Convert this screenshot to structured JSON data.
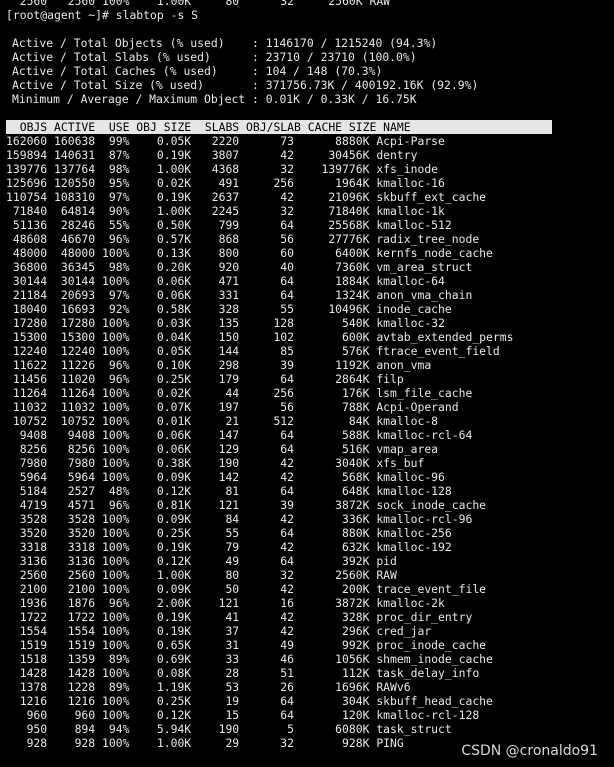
{
  "terminal": {
    "partial_top_line": "  2560   2560 100%    1.00K     80      32     2560K RAW",
    "prompt": "[root@agent ~]# slabtop -s S",
    "summary": [
      "Active / Total Objects (% used)    : 1146170 / 1215240 (94.3%)",
      "Active / Total Slabs (% used)      : 23710 / 23710 (100.0%)",
      "Active / Total Caches (% used)     : 104 / 148 (70.3%)",
      "Active / Total Size (% used)       : 371756.73K / 400192.16K (92.9%)",
      "Minimum / Average / Maximum Object : 0.01K / 0.33K / 16.75K"
    ],
    "header": "  OBJS ACTIVE  USE OBJ SIZE  SLABS OBJ/SLAB CACHE SIZE NAME",
    "rows": [
      "162060 160638  99%    0.05K   2220      73      8880K Acpi-Parse",
      "159894 140631  87%    0.19K   3807      42     30456K dentry",
      "139776 137764  98%    1.00K   4368      32    139776K xfs_inode",
      "125696 120550  95%    0.02K    491     256      1964K kmalloc-16",
      "110754 108310  97%    0.19K   2637      42     21096K skbuff_ext_cache",
      " 71840  64814  90%    1.00K   2245      32     71840K kmalloc-1k",
      " 51136  28246  55%    0.50K    799      64     25568K kmalloc-512",
      " 48608  46670  96%    0.57K    868      56     27776K radix_tree_node",
      " 48000  48000 100%    0.13K    800      60      6400K kernfs_node_cache",
      " 36800  36345  98%    0.20K    920      40      7360K vm_area_struct",
      " 30144  30144 100%    0.06K    471      64      1884K kmalloc-64",
      " 21184  20693  97%    0.06K    331      64      1324K anon_vma_chain",
      " 18040  16693  92%    0.58K    328      55     10496K inode_cache",
      " 17280  17280 100%    0.03K    135     128       540K kmalloc-32",
      " 15300  15300 100%    0.04K    150     102       600K avtab_extended_perms",
      " 12240  12240 100%    0.05K    144      85       576K ftrace_event_field",
      " 11622  11226  96%    0.10K    298      39      1192K anon_vma",
      " 11456  11020  96%    0.25K    179      64      2864K filp",
      " 11264  11264 100%    0.02K     44     256       176K lsm_file_cache",
      " 11032  11032 100%    0.07K    197      56       788K Acpi-Operand",
      " 10752  10752 100%    0.01K     21     512        84K kmalloc-8",
      "  9408   9408 100%    0.06K    147      64       588K kmalloc-rcl-64",
      "  8256   8256 100%    0.06K    129      64       516K vmap_area",
      "  7980   7980 100%    0.38K    190      42      3040K xfs_buf",
      "  5964   5964 100%    0.09K    142      42       568K kmalloc-96",
      "  5184   2527  48%    0.12K     81      64       648K kmalloc-128",
      "  4719   4571  96%    0.81K    121      39      3872K sock_inode_cache",
      "  3528   3528 100%    0.09K     84      42       336K kmalloc-rcl-96",
      "  3520   3520 100%    0.25K     55      64       880K kmalloc-256",
      "  3318   3318 100%    0.19K     79      42       632K kmalloc-192",
      "  3136   3136 100%    0.12K     49      64       392K pid",
      "  2560   2560 100%    1.00K     80      32      2560K RAW",
      "  2100   2100 100%    0.09K     50      42       200K trace_event_file",
      "  1936   1876  96%    2.00K    121      16      3872K kmalloc-2k",
      "  1722   1722 100%    0.19K     41      42       328K proc_dir_entry",
      "  1554   1554 100%    0.19K     37      42       296K cred_jar",
      "  1519   1519 100%    0.65K     31      49       992K proc_inode_cache",
      "  1518   1359  89%    0.69K     33      46      1056K shmem_inode_cache",
      "  1428   1428 100%    0.08K     28      51       112K task_delay_info",
      "  1378   1228  89%    1.19K     53      26      1696K RAWv6",
      "  1216   1216 100%    0.25K     19      64       304K skbuff_head_cache",
      "   960    960 100%    0.12K     15      64       120K kmalloc-rcl-128",
      "   950    894  94%    5.94K    190       5      6080K task_struct",
      "   928    928 100%    1.00K     29      32       928K PING"
    ]
  },
  "watermark": "CSDN @cronaldo91"
}
